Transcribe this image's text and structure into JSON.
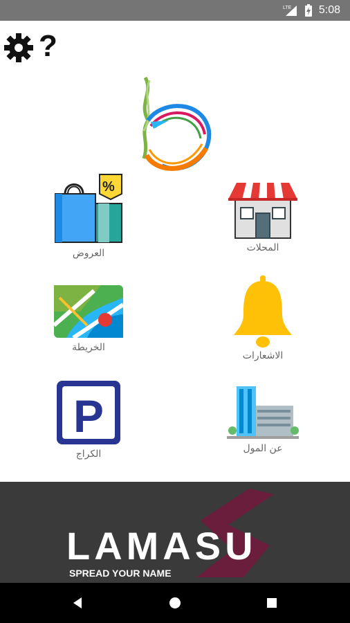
{
  "status_bar": {
    "time": "5:08",
    "network_label": "LTE",
    "icons": [
      "lte-signal-icon",
      "battery-icon"
    ]
  },
  "toolbar": {
    "settings_icon": "gear-icon",
    "help_icon": "question-mark-icon",
    "help_glyph": "?"
  },
  "logo": {
    "icon": "app-logo"
  },
  "tiles": [
    {
      "id": "offers",
      "label": "العروض",
      "icon": "shopping-bags-icon"
    },
    {
      "id": "shops",
      "label": "المحلات",
      "icon": "storefront-icon"
    },
    {
      "id": "map",
      "label": "الخريطة",
      "icon": "map-icon"
    },
    {
      "id": "notifications",
      "label": "الاشعارات",
      "icon": "bell-icon"
    },
    {
      "id": "garage",
      "label": "الكراج",
      "icon": "parking-icon"
    },
    {
      "id": "about",
      "label": "عن المول",
      "icon": "building-icon"
    }
  ],
  "banner": {
    "brand": "LAMASU",
    "tagline": "SPREAD YOUR NAME",
    "colors": {
      "background": "#3a3a3a",
      "accent": "#6b1d3c"
    }
  },
  "nav_bar": {
    "buttons": [
      "back-icon",
      "home-icon",
      "recents-icon"
    ]
  },
  "colors": {
    "status_bar": "#757575",
    "bell": "#ffc107",
    "parking": "#283593",
    "awning_red": "#e53935"
  }
}
